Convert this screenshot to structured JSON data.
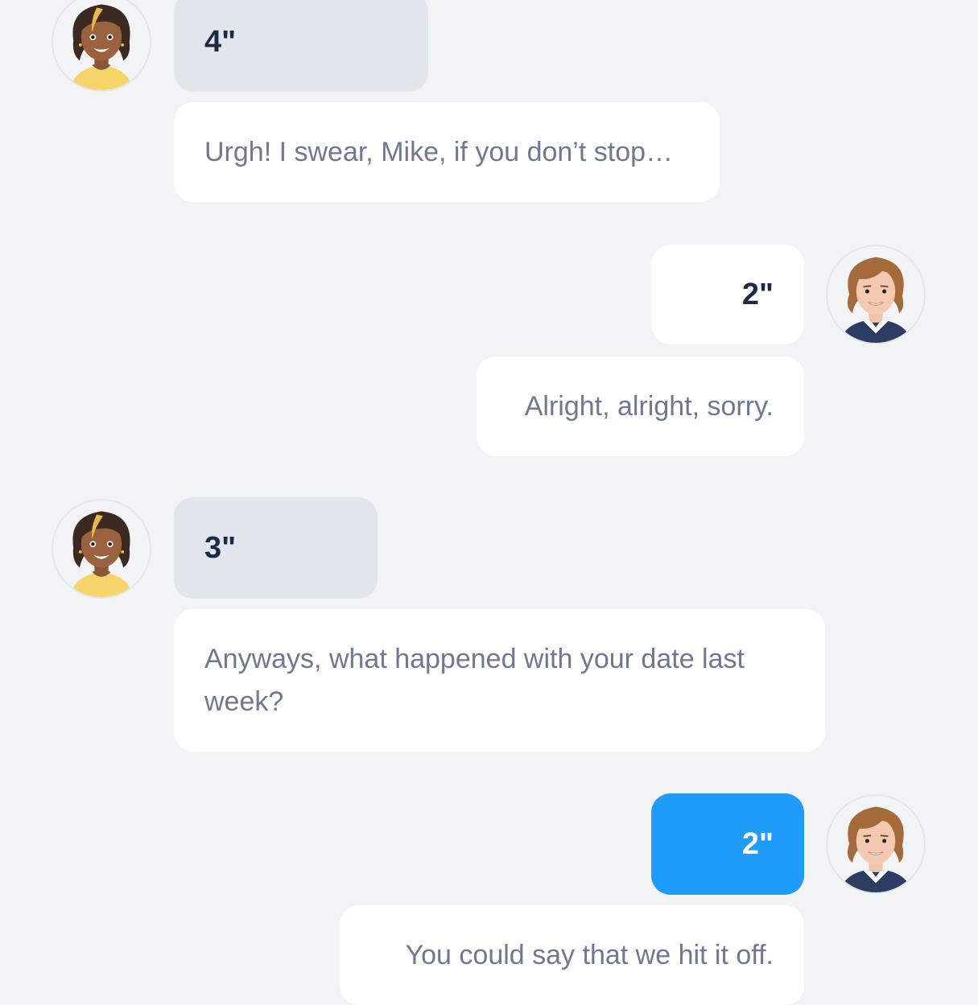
{
  "colors": {
    "background": "#f2f3f5",
    "bubble_white": "#ffffff",
    "bubble_gray": "#e1e5ec",
    "bubble_active": "#1f9bf8",
    "duration_text": "#1e2a44",
    "message_text": "#6e7890"
  },
  "conversation": [
    {
      "speaker": "female",
      "avatar_icon": "woman-avatar-icon",
      "duration": "4\"",
      "message": "Urgh! I swear, Mike, if you don’t stop…"
    },
    {
      "speaker": "male",
      "avatar_icon": "man-avatar-icon",
      "duration": "2\"",
      "message": "Alright, alright, sorry."
    },
    {
      "speaker": "female",
      "avatar_icon": "woman-avatar-icon",
      "duration": "3\"",
      "message": "Anyways, what happened with your date last week?"
    },
    {
      "speaker": "male",
      "avatar_icon": "man-avatar-icon",
      "duration": "2\"",
      "duration_active": true,
      "message": "You could say that we hit it off."
    }
  ]
}
